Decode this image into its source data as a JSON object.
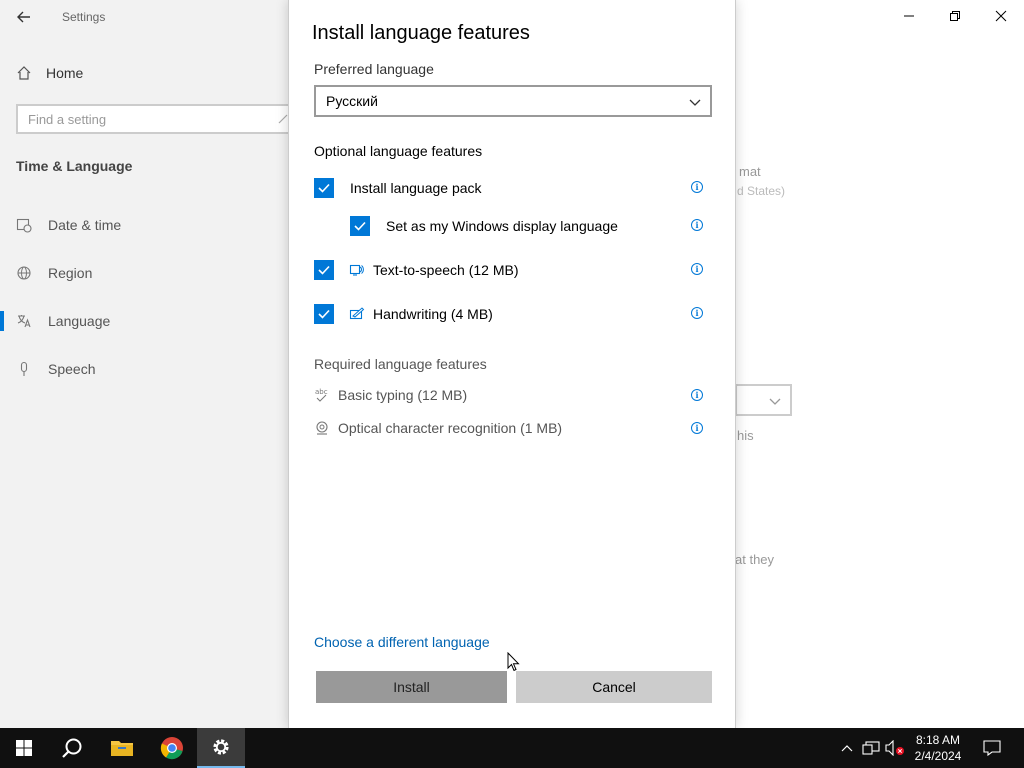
{
  "window": {
    "app_title": "Settings"
  },
  "sidebar": {
    "home_label": "Home",
    "search_placeholder": "Find a setting",
    "section_title": "Time & Language",
    "items": [
      {
        "label": "Date & time",
        "icon": "clock-calendar-icon"
      },
      {
        "label": "Region",
        "icon": "globe-icon"
      },
      {
        "label": "Language",
        "icon": "language-icon",
        "active": true
      },
      {
        "label": "Speech",
        "icon": "microphone-icon"
      }
    ]
  },
  "background": {
    "fragment_1": "mat",
    "fragment_2": "d States)",
    "fragment_3": "his",
    "fragment_4": "at they"
  },
  "dialog": {
    "title": "Install language features",
    "preferred_label": "Preferred language",
    "preferred_value": "Русский",
    "optional_label": "Optional language features",
    "optional_features": [
      {
        "label": "Install language pack",
        "checked": true
      },
      {
        "label": "Set as my Windows display language",
        "checked": true
      },
      {
        "label": "Text-to-speech (12 MB)",
        "checked": true,
        "icon": "speech-icon"
      },
      {
        "label": "Handwriting (4 MB)",
        "checked": true,
        "icon": "handwriting-icon"
      }
    ],
    "required_label": "Required language features",
    "required_features": [
      {
        "label": "Basic typing (12 MB)",
        "icon": "typing-abc-icon"
      },
      {
        "label": "Optical character recognition (1 MB)",
        "icon": "ocr-icon"
      }
    ],
    "choose_link": "Choose a different language",
    "install_label": "Install",
    "cancel_label": "Cancel"
  },
  "taskbar": {
    "time": "8:18 AM",
    "date": "2/4/2024"
  },
  "colors": {
    "accent": "#0078d7",
    "link": "#0063b1",
    "taskbar": "#101010"
  }
}
